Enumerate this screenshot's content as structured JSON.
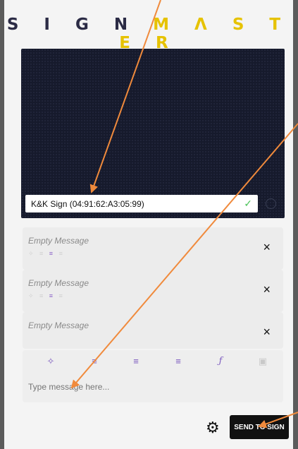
{
  "app": {
    "logo": {
      "part1": "S I G N",
      "part2": "M Λ S T E R"
    }
  },
  "screen": {
    "connection_label": "K&K Sign (04:91:62:A3:05:99)",
    "check_icon": "✓"
  },
  "messages": [
    {
      "label": "Empty Message",
      "close": "×"
    },
    {
      "label": "Empty Message",
      "close": "×"
    },
    {
      "label": "Empty Message",
      "close": "×"
    }
  ],
  "editor": {
    "placeholder": "Type message here...",
    "tools": [
      "sparkle-icon",
      "align-left-icon",
      "align-center-icon",
      "align-right-icon",
      "font-icon",
      "image-icon"
    ]
  },
  "footer": {
    "send_label": "SEND TO SIGN"
  },
  "colors": {
    "accent": "#7c5bbf",
    "logo_dark": "#2b2b45",
    "logo_yellow": "#e6c200",
    "annotation": "#f08a3c"
  }
}
